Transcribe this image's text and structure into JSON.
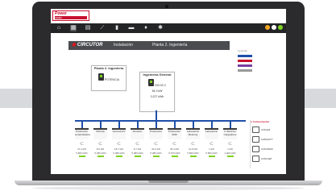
{
  "logo": {
    "line1": "Power",
    "line2": "studio"
  },
  "toolbar": {
    "icons": [
      "home-icon",
      "grid-icon",
      "document-icon",
      "chart-icon",
      "bars-icon",
      "book-icon",
      "bell-icon",
      "gear-icon"
    ],
    "status_colors": [
      "#f5a623",
      "#ffffff",
      "#7ed321"
    ]
  },
  "header": {
    "brand": "CIRCUTOR",
    "crumbs": [
      "Instalación",
      "Planta 2. Ingeniería"
    ]
  },
  "legend": {
    "title": "Leyenda",
    "colors": [
      "#1f4fa8",
      "#c8102e",
      "#7b3fa0",
      "#999999"
    ]
  },
  "top_boxes": {
    "planta": {
      "title": "Planta 2. Ingeniería",
      "value": "POTENCIA"
    },
    "general": {
      "title": "Ingeniería General",
      "v1": "230.00 V",
      "v2": "54.3 kW",
      "v3": "3.227 kWh"
    }
  },
  "feeders": [
    {
      "name": "Producción ensambladora",
      "kw": "47.4 kW",
      "kwh": "5.800 kWh"
    },
    {
      "name": "Oficinas",
      "kw": "8.6 kW",
      "kwh": "5.380 kWh"
    },
    {
      "name": "General HV",
      "kw": "18.7 kW",
      "kwh": "5.380 kWh"
    },
    {
      "name": "Almacén",
      "kw": "8.7 kW",
      "kwh": "5.380 kWh"
    },
    {
      "name": "Producción",
      "kw": "43.2 kW",
      "kwh": "5.380 kWh"
    },
    {
      "name": "Producción SMD",
      "kw": "36.3 kW",
      "kwh": "5.670 kWh"
    },
    {
      "name": "Laboratorio Metering",
      "kw": "12.8 kW",
      "kwh": "5.800 kWh"
    },
    {
      "name": "Laboratorio",
      "kw": "1 kW",
      "kwh": "5.800 kWh"
    },
    {
      "name": "V. Eléctrico Cargadores",
      "kw": "1 kW",
      "kwh": "1.000 kWh"
    }
  ],
  "panel": {
    "title": "Comunicación",
    "items": [
      "CVM-E3",
      "CAPACITY",
      "CVM-B100",
      "CVM-NET"
    ]
  }
}
